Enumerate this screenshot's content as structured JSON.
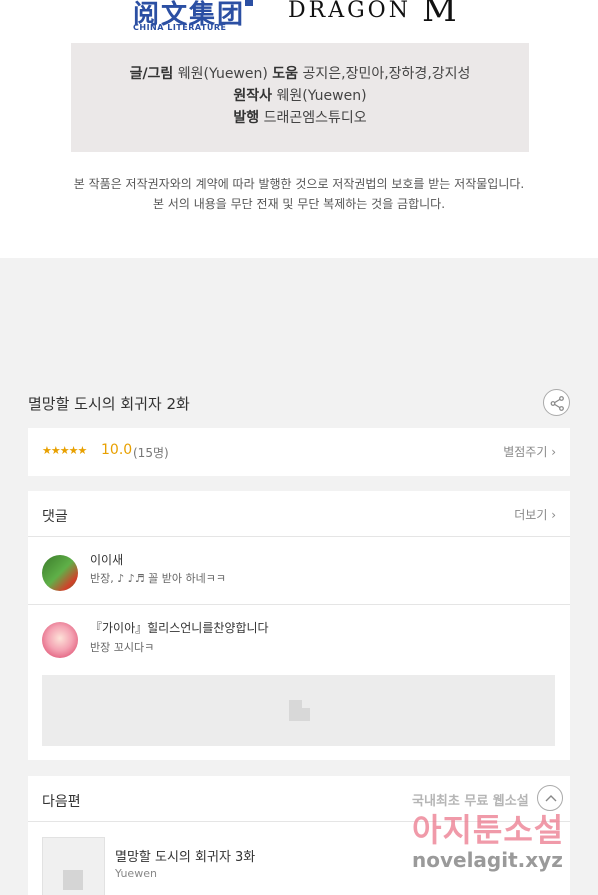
{
  "header": {
    "logo_left": "阅文集团",
    "logo_left_sub": "CHINA LITERATURE",
    "logo_right": "DRAGON",
    "logo_right_mark": "M"
  },
  "credits": {
    "line1_label": "글/그림",
    "line1_value": " 웨원(Yuewen) ",
    "line1_label2": "도움",
    "line1_value2": " 공지은,장민아,장하경,강지성",
    "line2_label": "원작사",
    "line2_value": " 웨원(Yuewen)",
    "line3_label": "발행",
    "line3_value": " 드래곤엠스튜디오"
  },
  "notice": {
    "line1": "본 작품은 저작권자와의 계약에 따라 발행한 것으로 저작권법의 보호를 받는 저작물입니다.",
    "line2": "본 서의 내용을 무단 전재 및 무단 복제하는 것을 금합니다."
  },
  "episode": {
    "title": "멸망할 도시의 회귀자 2화",
    "share_icon": "share-icon"
  },
  "rating": {
    "stars": "★★★★★",
    "score": "10.0",
    "votes": "(15명)",
    "rate_link": "별점주기 ›"
  },
  "comments": {
    "title": "댓글",
    "more": "더보기 ›",
    "items": [
      {
        "nick": "이이새",
        "text": "반장, ♪ ♪♬ 꼴 받아 하네ㅋㅋ"
      },
      {
        "nick": "『가이아』힐리스언니를찬양합니다",
        "text": "반장 꼬시다ㅋ"
      }
    ]
  },
  "next": {
    "title": "다음편",
    "episode_title": "멸망할 도시의 회귀자 3화",
    "author": "Yuewen"
  },
  "watermark": {
    "line1": "국내최초 무료 웹소설",
    "line2": "아지툰소설",
    "line3": "novelagit.xyz"
  },
  "colors": {
    "accent": "#e8a000",
    "background": "#f2f2f2",
    "card": "#ffffff"
  }
}
